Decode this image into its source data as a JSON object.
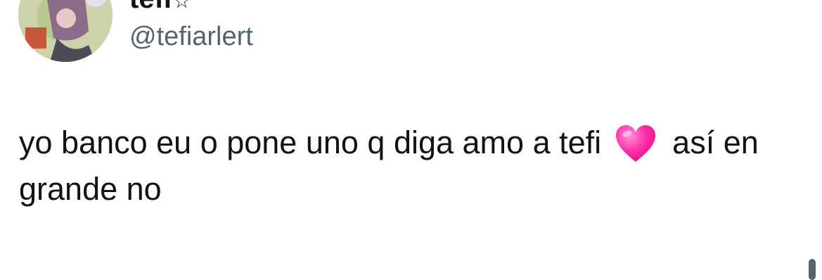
{
  "author": {
    "display_name": "tefi",
    "name_badge": "☆",
    "handle": "@tefiarlert"
  },
  "tweet": {
    "text_before_emoji": "yo banco eu o pone uno q diga amo a tefi",
    "emoji": "pink-heart",
    "text_after_emoji": "así en grande no"
  },
  "colors": {
    "primary_text": "#0f1419",
    "secondary_text": "#536471",
    "heart": "#ff2fa8",
    "background": "#ffffff"
  }
}
